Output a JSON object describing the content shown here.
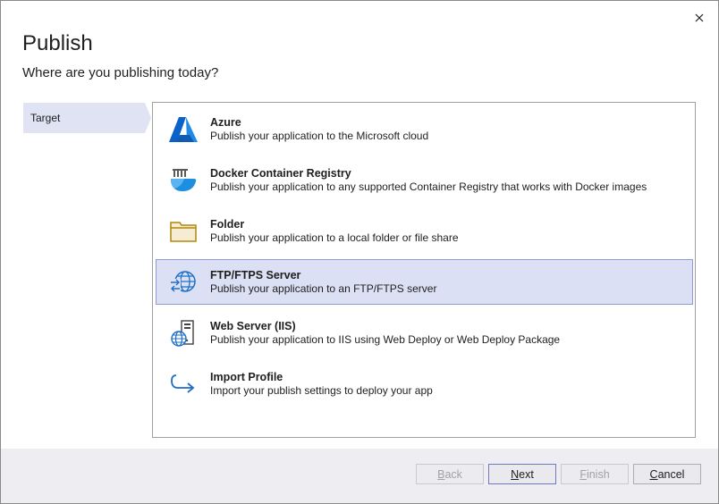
{
  "dialog": {
    "title": "Publish",
    "subtitle": "Where are you publishing today?"
  },
  "steps": [
    {
      "label": "Target"
    }
  ],
  "options": [
    {
      "icon": "azure-icon",
      "title": "Azure",
      "description": "Publish your application to the Microsoft cloud"
    },
    {
      "icon": "docker-icon",
      "title": "Docker Container Registry",
      "description": "Publish your application to any supported Container Registry that works with Docker images"
    },
    {
      "icon": "folder-icon",
      "title": "Folder",
      "description": "Publish your application to a local folder or file share"
    },
    {
      "icon": "ftp-globe-icon",
      "title": "FTP/FTPS Server",
      "description": "Publish your application to an FTP/FTPS server",
      "selected": true
    },
    {
      "icon": "web-server-icon",
      "title": "Web Server (IIS)",
      "description": "Publish your application to IIS using Web Deploy or Web Deploy Package"
    },
    {
      "icon": "import-arrow-icon",
      "title": "Import Profile",
      "description": "Import your publish settings to deploy your app"
    }
  ],
  "buttons": {
    "back": {
      "mnemonic": "B",
      "rest": "ack",
      "enabled": false
    },
    "next": {
      "mnemonic": "N",
      "rest": "ext",
      "enabled": true
    },
    "finish": {
      "mnemonic": "F",
      "rest": "inish",
      "enabled": false
    },
    "cancel": {
      "mnemonic": "C",
      "rest": "ancel",
      "enabled": true
    }
  },
  "colors": {
    "accent": "#0078d4",
    "selected_bg": "#dce0f5",
    "step_bg": "#dfe3f3",
    "folder": "#b8860b"
  }
}
